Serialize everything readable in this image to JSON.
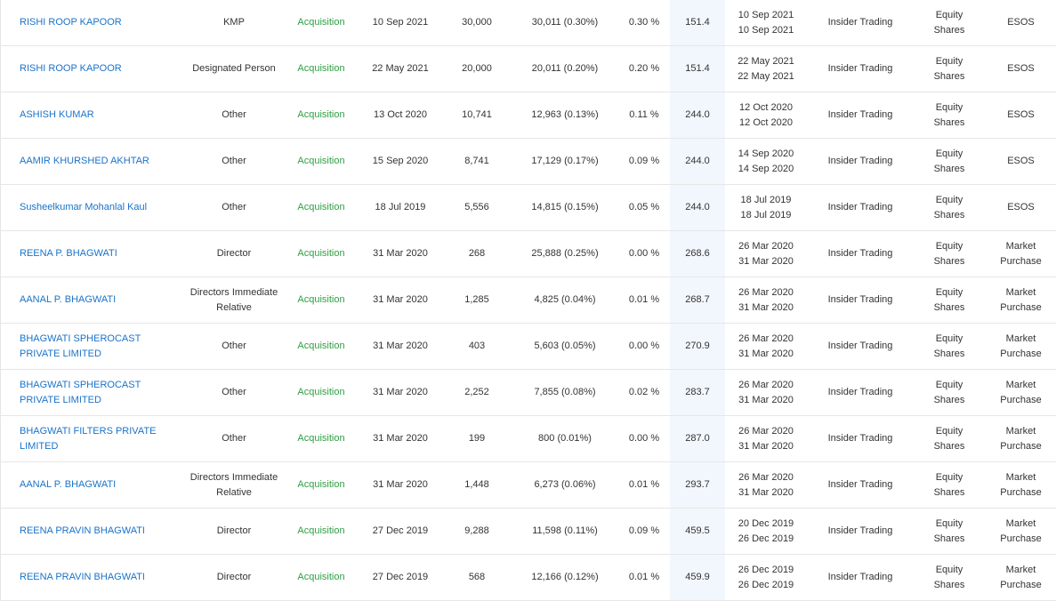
{
  "rows": [
    {
      "name": "RISHI ROOP KAPOOR",
      "category": "KMP",
      "type": "Acquisition",
      "date": "10 Sep 2021",
      "qty": "30,000",
      "holding": "30,011 (0.30%)",
      "change": "0.30 %",
      "price": "151.4",
      "period_from": "10 Sep 2021",
      "period_to": "10 Sep 2021",
      "mode": "Insider Trading",
      "security_1": "Equity",
      "security_2": "Shares",
      "acq_1": "ESOS",
      "acq_2": ""
    },
    {
      "name": "RISHI ROOP KAPOOR",
      "category": "Designated Person",
      "type": "Acquisition",
      "date": "22 May 2021",
      "qty": "20,000",
      "holding": "20,011 (0.20%)",
      "change": "0.20 %",
      "price": "151.4",
      "period_from": "22 May 2021",
      "period_to": "22 May 2021",
      "mode": "Insider Trading",
      "security_1": "Equity",
      "security_2": "Shares",
      "acq_1": "ESOS",
      "acq_2": ""
    },
    {
      "name": "ASHISH KUMAR",
      "category": "Other",
      "type": "Acquisition",
      "date": "13 Oct 2020",
      "qty": "10,741",
      "holding": "12,963 (0.13%)",
      "change": "0.11 %",
      "price": "244.0",
      "period_from": "12 Oct 2020",
      "period_to": "12 Oct 2020",
      "mode": "Insider Trading",
      "security_1": "Equity",
      "security_2": "Shares",
      "acq_1": "ESOS",
      "acq_2": ""
    },
    {
      "name": "AAMIR KHURSHED AKHTAR",
      "category": "Other",
      "type": "Acquisition",
      "date": "15 Sep 2020",
      "qty": "8,741",
      "holding": "17,129 (0.17%)",
      "change": "0.09 %",
      "price": "244.0",
      "period_from": "14 Sep 2020",
      "period_to": "14 Sep 2020",
      "mode": "Insider Trading",
      "security_1": "Equity",
      "security_2": "Shares",
      "acq_1": "ESOS",
      "acq_2": ""
    },
    {
      "name": "Susheelkumar Mohanlal Kaul",
      "category": "Other",
      "type": "Acquisition",
      "date": "18 Jul 2019",
      "qty": "5,556",
      "holding": "14,815 (0.15%)",
      "change": "0.05 %",
      "price": "244.0",
      "period_from": "18 Jul 2019",
      "period_to": "18 Jul 2019",
      "mode": "Insider Trading",
      "security_1": "Equity",
      "security_2": "Shares",
      "acq_1": "ESOS",
      "acq_2": ""
    },
    {
      "name": "REENA P. BHAGWATI",
      "category": "Director",
      "type": "Acquisition",
      "date": "31 Mar 2020",
      "qty": "268",
      "holding": "25,888 (0.25%)",
      "change": "0.00 %",
      "price": "268.6",
      "period_from": "26 Mar 2020",
      "period_to": "31 Mar 2020",
      "mode": "Insider Trading",
      "security_1": "Equity",
      "security_2": "Shares",
      "acq_1": "Market",
      "acq_2": "Purchase"
    },
    {
      "name": "AANAL P. BHAGWATI",
      "category": "Directors Immediate Relative",
      "type": "Acquisition",
      "date": "31 Mar 2020",
      "qty": "1,285",
      "holding": "4,825 (0.04%)",
      "change": "0.01 %",
      "price": "268.7",
      "period_from": "26 Mar 2020",
      "period_to": "31 Mar 2020",
      "mode": "Insider Trading",
      "security_1": "Equity",
      "security_2": "Shares",
      "acq_1": "Market",
      "acq_2": "Purchase"
    },
    {
      "name": "BHAGWATI SPHEROCAST PRIVATE LIMITED",
      "category": "Other",
      "type": "Acquisition",
      "date": "31 Mar 2020",
      "qty": "403",
      "holding": "5,603 (0.05%)",
      "change": "0.00 %",
      "price": "270.9",
      "period_from": "26 Mar 2020",
      "period_to": "31 Mar 2020",
      "mode": "Insider Trading",
      "security_1": "Equity",
      "security_2": "Shares",
      "acq_1": "Market",
      "acq_2": "Purchase"
    },
    {
      "name": "BHAGWATI SPHEROCAST PRIVATE LIMITED",
      "category": "Other",
      "type": "Acquisition",
      "date": "31 Mar 2020",
      "qty": "2,252",
      "holding": "7,855 (0.08%)",
      "change": "0.02 %",
      "price": "283.7",
      "period_from": "26 Mar 2020",
      "period_to": "31 Mar 2020",
      "mode": "Insider Trading",
      "security_1": "Equity",
      "security_2": "Shares",
      "acq_1": "Market",
      "acq_2": "Purchase"
    },
    {
      "name": "BHAGWATI FILTERS PRIVATE LIMITED",
      "category": "Other",
      "type": "Acquisition",
      "date": "31 Mar 2020",
      "qty": "199",
      "holding": "800 (0.01%)",
      "change": "0.00 %",
      "price": "287.0",
      "period_from": "26 Mar 2020",
      "period_to": "31 Mar 2020",
      "mode": "Insider Trading",
      "security_1": "Equity",
      "security_2": "Shares",
      "acq_1": "Market",
      "acq_2": "Purchase"
    },
    {
      "name": "AANAL P. BHAGWATI",
      "category": "Directors Immediate Relative",
      "type": "Acquisition",
      "date": "31 Mar 2020",
      "qty": "1,448",
      "holding": "6,273 (0.06%)",
      "change": "0.01 %",
      "price": "293.7",
      "period_from": "26 Mar 2020",
      "period_to": "31 Mar 2020",
      "mode": "Insider Trading",
      "security_1": "Equity",
      "security_2": "Shares",
      "acq_1": "Market",
      "acq_2": "Purchase"
    },
    {
      "name": "REENA PRAVIN BHAGWATI",
      "category": "Director",
      "type": "Acquisition",
      "date": "27 Dec 2019",
      "qty": "9,288",
      "holding": "11,598 (0.11%)",
      "change": "0.09 %",
      "price": "459.5",
      "period_from": "20 Dec 2019",
      "period_to": "26 Dec 2019",
      "mode": "Insider Trading",
      "security_1": "Equity",
      "security_2": "Shares",
      "acq_1": "Market",
      "acq_2": "Purchase"
    },
    {
      "name": "REENA PRAVIN BHAGWATI",
      "category": "Director",
      "type": "Acquisition",
      "date": "27 Dec 2019",
      "qty": "568",
      "holding": "12,166 (0.12%)",
      "change": "0.01 %",
      "price": "459.9",
      "period_from": "26 Dec 2019",
      "period_to": "26 Dec 2019",
      "mode": "Insider Trading",
      "security_1": "Equity",
      "security_2": "Shares",
      "acq_1": "Market",
      "acq_2": "Purchase"
    }
  ]
}
